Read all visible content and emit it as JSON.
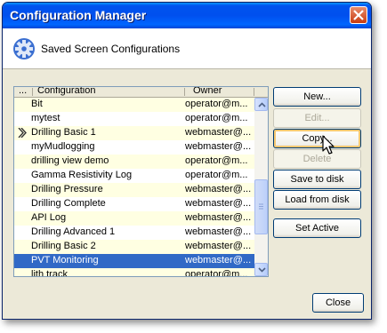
{
  "window": {
    "title": "Configuration Manager"
  },
  "header": {
    "title": "Saved Screen Configurations",
    "icon": "gear-icon"
  },
  "table": {
    "columns": {
      "marker": "...",
      "configuration": "Configuration",
      "owner": "Owner"
    },
    "rows": [
      {
        "name": "Bit",
        "owner": "operator@m..."
      },
      {
        "name": "mytest",
        "owner": "operator@m..."
      },
      {
        "name": "Drilling Basic 1",
        "owner": "webmaster@...",
        "current": true
      },
      {
        "name": "myMudlogging",
        "owner": "webmaster@..."
      },
      {
        "name": "drilling view demo",
        "owner": "operator@m..."
      },
      {
        "name": "Gamma Resistivity Log",
        "owner": "operator@m..."
      },
      {
        "name": "Drilling Pressure",
        "owner": "webmaster@..."
      },
      {
        "name": "Drilling Complete",
        "owner": "webmaster@..."
      },
      {
        "name": "API Log",
        "owner": "webmaster@..."
      },
      {
        "name": "Drilling Advanced 1",
        "owner": "webmaster@..."
      },
      {
        "name": "Drilling Basic 2",
        "owner": "webmaster@..."
      },
      {
        "name": "PVT Monitoring",
        "owner": "webmaster@...",
        "selected": true
      },
      {
        "name": "lith track",
        "owner": "operator@m..."
      }
    ]
  },
  "buttons": {
    "new": "New...",
    "edit": "Edit...",
    "copy": "Copy...",
    "delete": "Delete",
    "save_to_disk": "Save to disk",
    "load_from_disk": "Load from disk",
    "set_active": "Set Active",
    "close": "Close"
  },
  "colors": {
    "selection": "#3169c6",
    "row_alt": "#ffffe2",
    "titlebar": "#0054e3"
  }
}
